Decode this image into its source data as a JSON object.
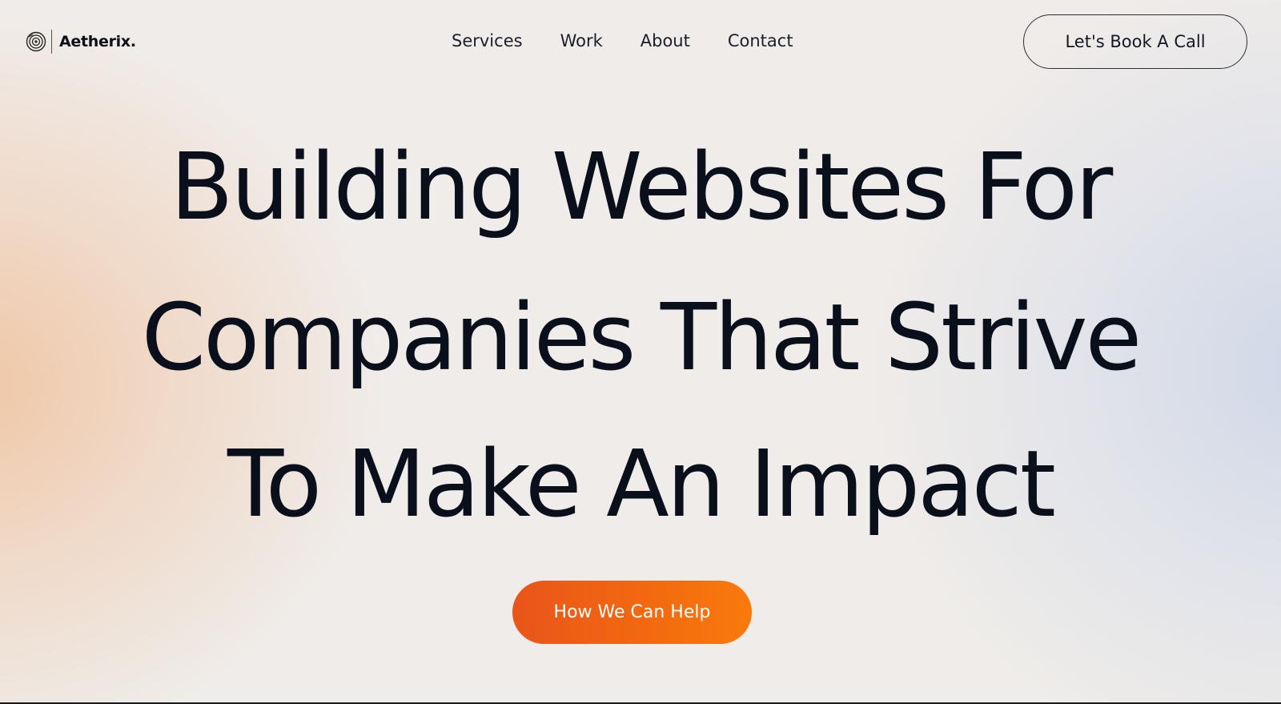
{
  "brand": {
    "logo_icon": "concentric-rings-logo-icon",
    "name": "Aetherix."
  },
  "nav": {
    "items": [
      {
        "label": "Services"
      },
      {
        "label": "Work"
      },
      {
        "label": "About"
      },
      {
        "label": "Contact"
      }
    ],
    "cta_label": "Let's Book A Call"
  },
  "hero": {
    "lines": [
      "Building Websites For",
      "Companies That Strive",
      "To Make An Impact"
    ],
    "button_label": "How We Can Help"
  },
  "colors": {
    "text": "#0a0f1c",
    "accent_start": "#e9551a",
    "accent_end": "#f97a0c",
    "warm_glow": "#f0c4a0",
    "cool_glow": "#ced6e8",
    "background": "#efecea"
  }
}
